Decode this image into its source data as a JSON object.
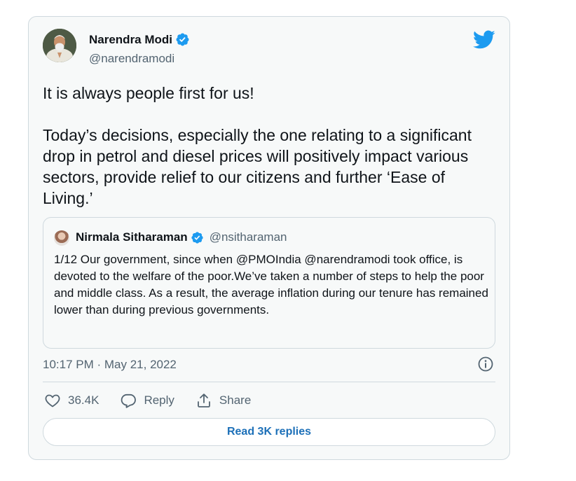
{
  "tweet": {
    "author": {
      "name": "Narendra Modi",
      "handle": "@narendramodi",
      "verified": true
    },
    "text": "It is always people first for us!\n\nToday’s decisions, especially the one relating to a significant drop in petrol and diesel prices will positively impact various sectors, provide relief to our citizens and further ‘Ease of Living.’",
    "quoted": {
      "name": "Nirmala Sitharaman",
      "handle": "@nsitharaman",
      "verified": true,
      "text": "1/12  Our government, since when @PMOIndia @narendramodi took office, is\ndevoted to the welfare of the poor.We’ve taken a number of steps to help the poor and middle class. As a result, the average inflation during our tenure has remained lower than during previous governments."
    },
    "timestamp": "10:17 PM · May 21, 2022",
    "actions": {
      "likes": "36.4K",
      "reply_label": "Reply",
      "share_label": "Share"
    },
    "read_replies_label": "Read 3K replies"
  },
  "icons": {
    "brand": "twitter-bird-icon",
    "verified": "verified-badge-icon",
    "info": "info-icon",
    "like": "heart-icon",
    "reply": "reply-bubble-icon",
    "share": "share-icon"
  },
  "colors": {
    "twitter_blue": "#1d9bf0",
    "link_blue": "#1d70b8",
    "card_bg": "#f7f9f9",
    "secondary_text": "#536471"
  }
}
